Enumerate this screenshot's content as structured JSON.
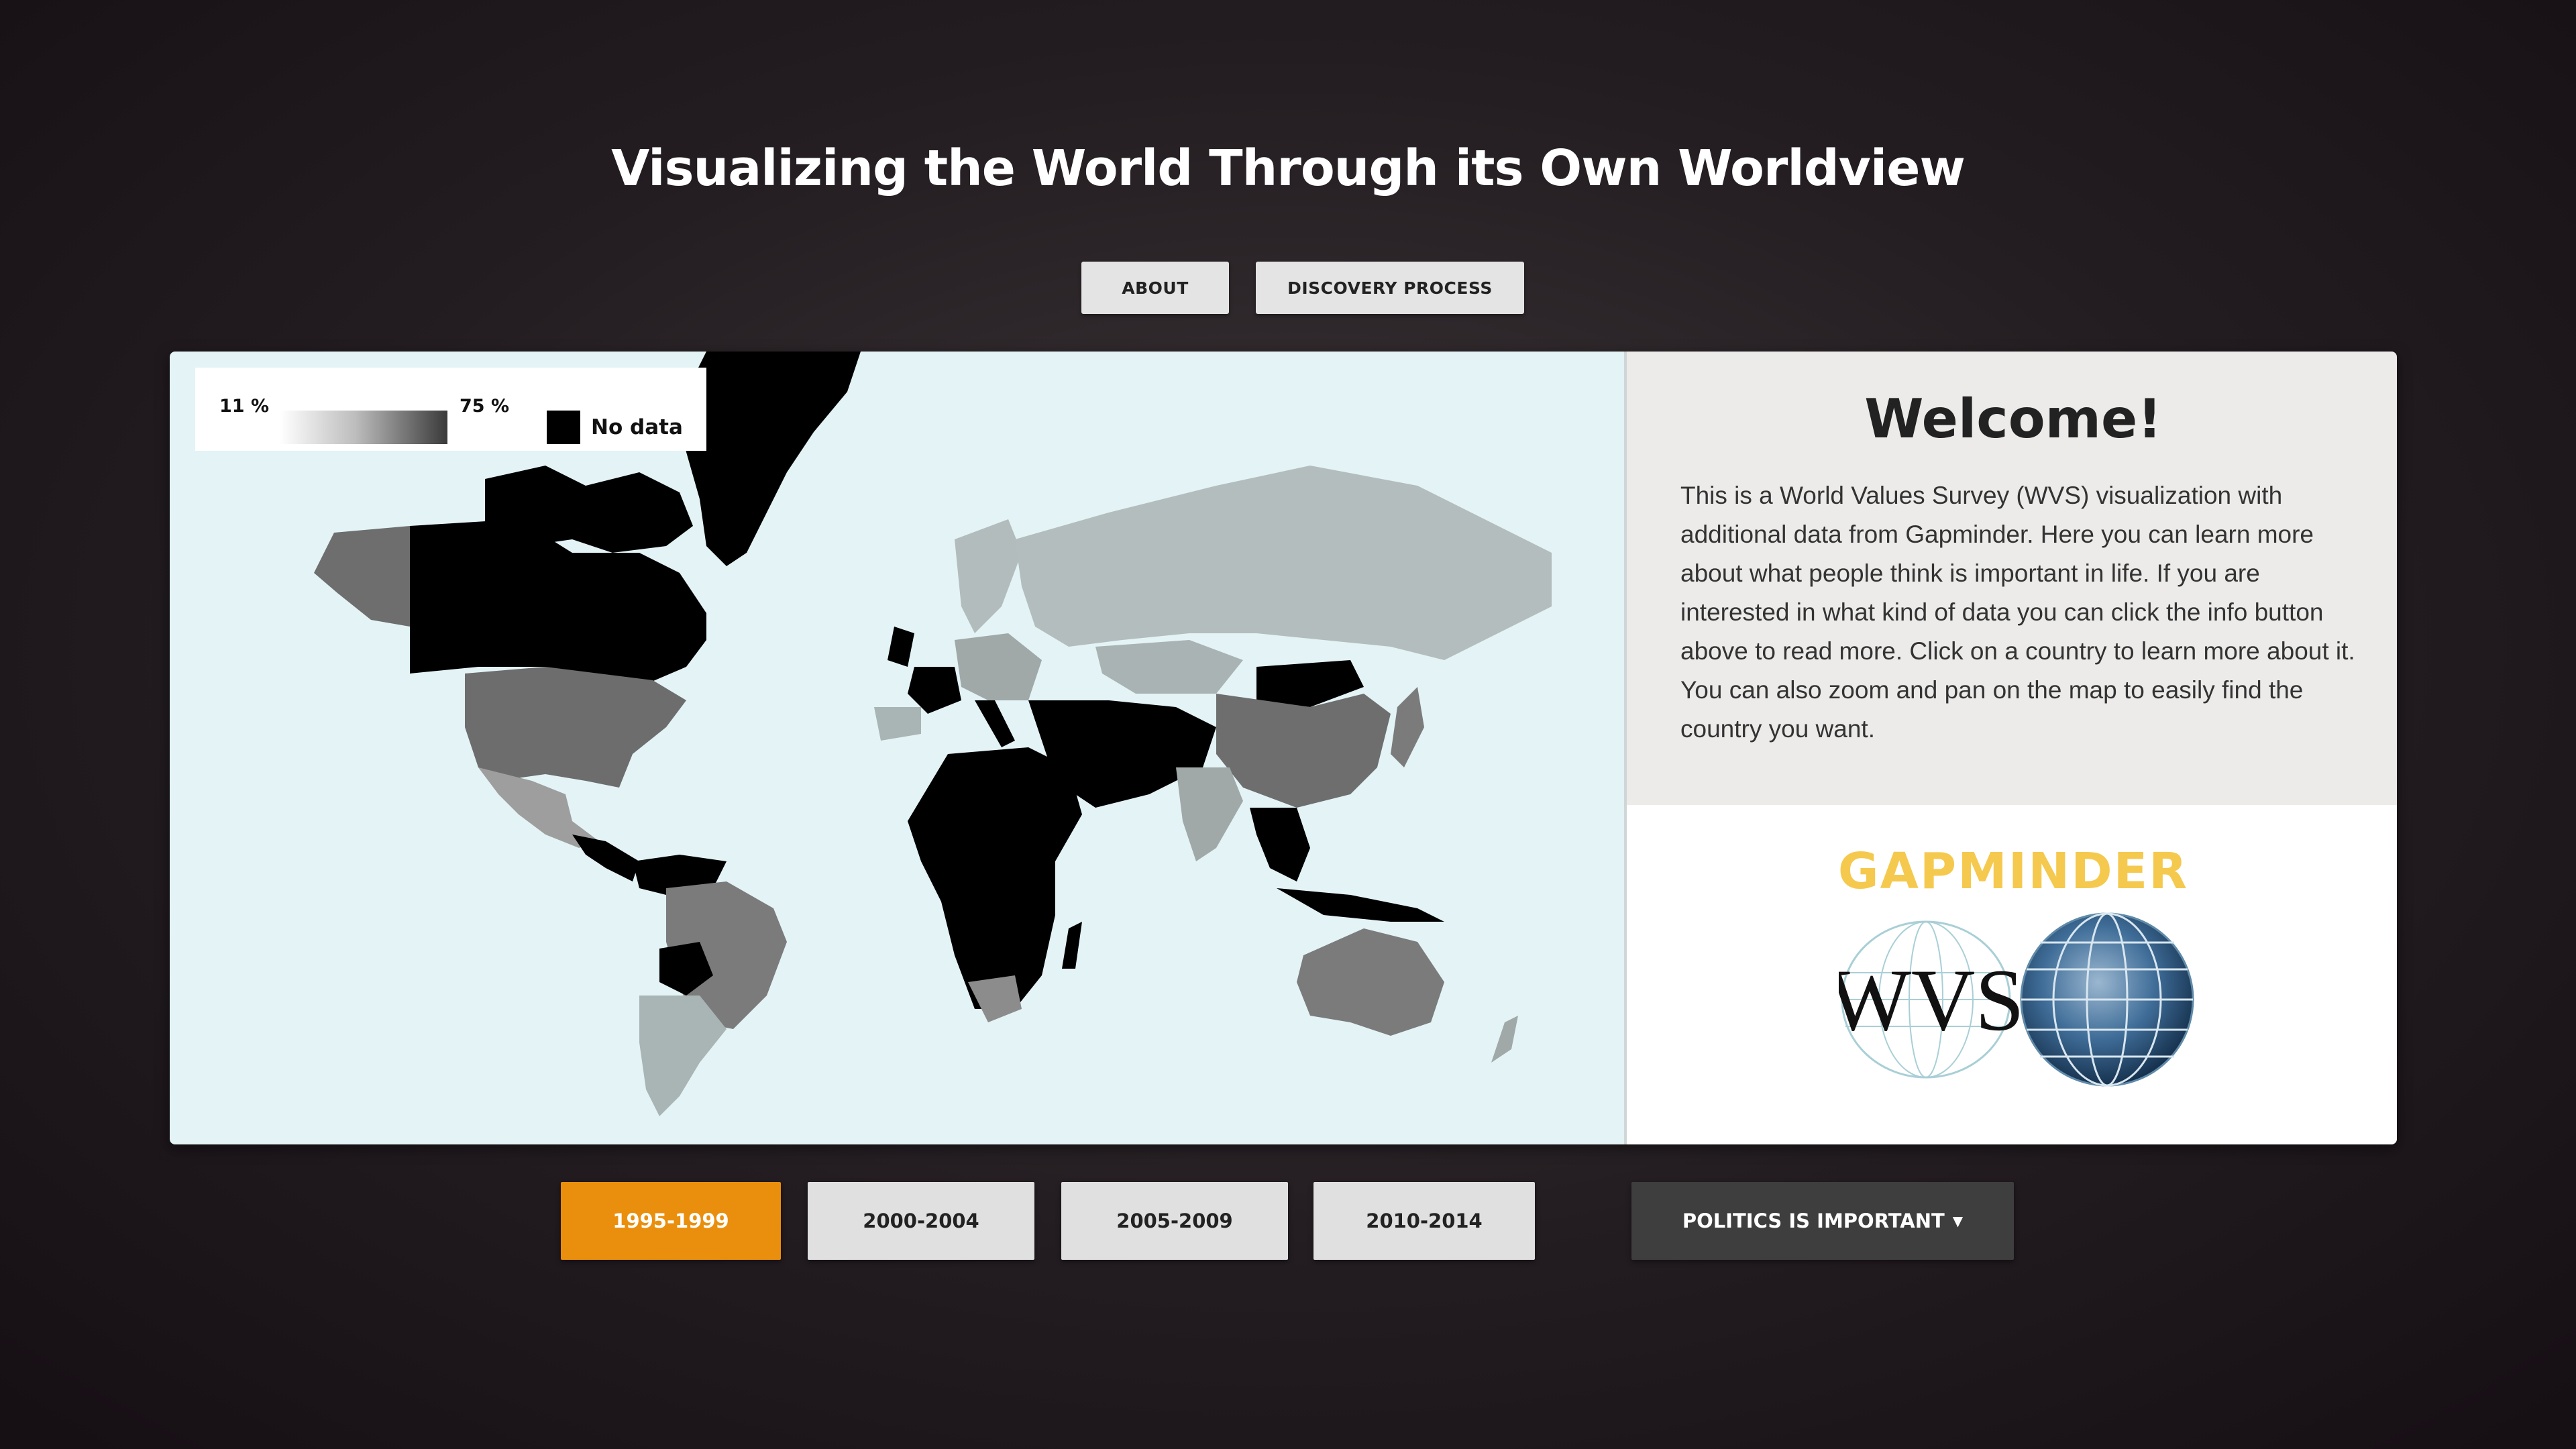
{
  "header": {
    "title": "Visualizing the World Through its Own Worldview",
    "about_label": "ABOUT",
    "discovery_label": "DISCOVERY PROCESS"
  },
  "legend": {
    "min_label": "11 %",
    "max_label": "75 %",
    "no_data_label": "No data",
    "no_data_color": "#000000"
  },
  "welcome": {
    "title": "Welcome!",
    "text": "This is a World Values Survey (WVS) visualization with additional data from Gapminder. Here you can learn more about what people think is important in life. If you are interested in what kind of data you can click the info button above to read more. Click on a country to learn more about it. You can also zoom and pan on the map to easily find the country you want."
  },
  "logos": {
    "gapminder": "GAPMINDER",
    "wvs": "WVS"
  },
  "controls": {
    "periods": [
      "1995-1999",
      "2000-2004",
      "2005-2009",
      "2010-2014"
    ],
    "active_period": "1995-1999",
    "question_label": "POLITICS IS IMPORTANT",
    "active_color": "#ea8f0d"
  },
  "icons": {
    "dropdown": "caret-down-icon",
    "wvs_globe": "globe-icon"
  }
}
